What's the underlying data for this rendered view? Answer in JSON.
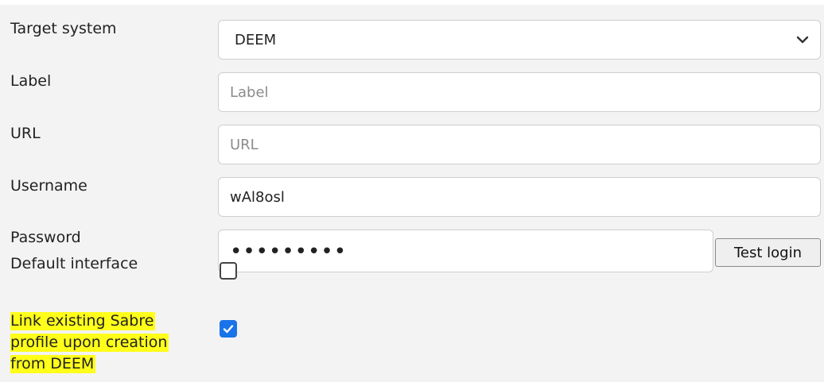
{
  "form": {
    "target_system": {
      "label": "Target system",
      "value": "DEEM"
    },
    "label_field": {
      "label": "Label",
      "value": "",
      "placeholder": "Label"
    },
    "url_field": {
      "label": "URL",
      "value": "",
      "placeholder": "URL"
    },
    "username": {
      "label": "Username",
      "value": "wAl8osl"
    },
    "password": {
      "label": "Password",
      "masked_value": "•••••••••"
    },
    "test_login_button": "Test login",
    "default_interface": {
      "label": "Default interface",
      "checked": false
    },
    "link_sabre": {
      "label_line1": "Link existing Sabre",
      "label_line2": "profile upon creation",
      "label_line3": "from DEEM",
      "checked": true
    }
  },
  "icons": {
    "dropdown": "chevron-down-icon",
    "checkmark": "checkmark-icon"
  },
  "colors": {
    "checkbox_checked": "#1a73e8",
    "highlight": "#ffff1a",
    "panel_background": "#f3f3f3"
  }
}
